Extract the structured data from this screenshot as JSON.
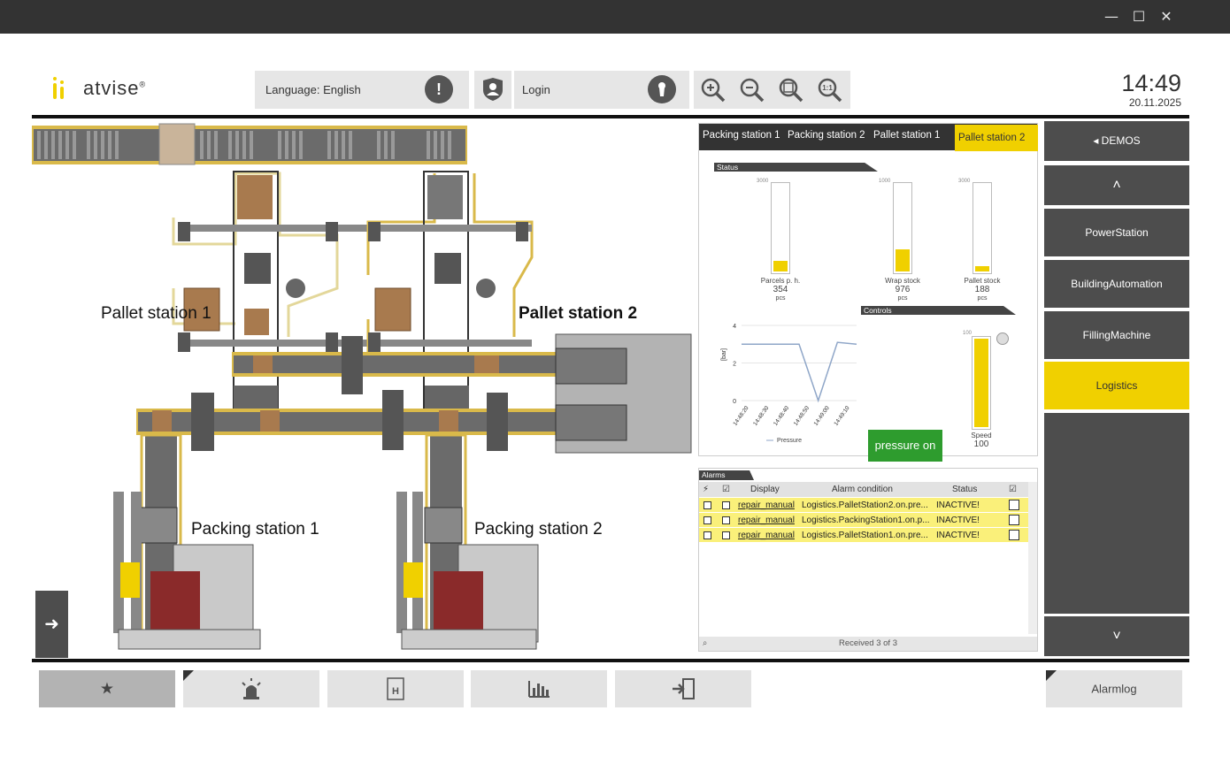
{
  "window": {
    "minimize_glyph": "—",
    "maximize_glyph": "☐",
    "close_glyph": "✕"
  },
  "header": {
    "logo_text": "atvise",
    "logo_reg": "®",
    "language_label": "Language: English",
    "login_label": "Login",
    "clock_time": "14:49",
    "clock_date": "20.11.2025",
    "zoom_in_label": "+",
    "zoom_out_label": "−",
    "zoom_fit_label": "□",
    "zoom_1to1_label": "1:1"
  },
  "process": {
    "labels": {
      "pallet1": "Pallet station 1",
      "pallet2": "Pallet station 2",
      "packing1": "Packing station 1",
      "packing2": "Packing station 2"
    },
    "exit_glyph": "➜"
  },
  "panel": {
    "tabs": [
      "Packing station 1",
      "Packing station 2",
      "Pallet station 1",
      "Pallet station 2"
    ],
    "active_tab": 3,
    "status_header": "Status",
    "controls_header": "Controls",
    "tanks": [
      {
        "top": "3000",
        "label": "Parcels p. h.",
        "value": "354",
        "unit": "pcs",
        "fill": 0.118
      },
      {
        "top": "1000",
        "label": "Wrap stock",
        "value": "976",
        "unit": "pcs",
        "fill": 0.25
      },
      {
        "top": "3000",
        "label": "Pallet stock",
        "value": "188",
        "unit": "pcs",
        "fill": 0.063
      }
    ],
    "speed": {
      "top": "100",
      "label": "Speed",
      "value": "100",
      "fill": 1.0
    },
    "pressure_button": "pressure on",
    "chart_legend": "Pressure"
  },
  "chart_data": {
    "type": "line",
    "x": [
      "14:48:20",
      "14:48:30",
      "14:48:40",
      "14:48:50",
      "14:49:00",
      "14:49:10"
    ],
    "ylabel": "[bar]",
    "yticks": [
      "0",
      "2",
      "4"
    ],
    "ylim": [
      0,
      4
    ],
    "series": [
      {
        "name": "Pressure",
        "values": [
          3.0,
          3.0,
          3.0,
          3.0,
          0.0,
          3.1,
          3.0
        ]
      }
    ]
  },
  "alarms": {
    "title": "Alarms",
    "columns": [
      "Display",
      "Alarm condition",
      "Status"
    ],
    "rows": [
      {
        "display": "repair_manual",
        "condition": "Logistics.PalletStation2.on.pre...",
        "status": "INACTIVE!"
      },
      {
        "display": "repair_manual",
        "condition": "Logistics.PackingStation1.on.p...",
        "status": "INACTIVE!"
      },
      {
        "display": "repair_manual",
        "condition": "Logistics.PalletStation1.on.pre...",
        "status": "INACTIVE!"
      }
    ],
    "footer": "Received 3 of 3"
  },
  "nav": {
    "demos": "◂ DEMOS",
    "up": "˄",
    "items": [
      "PowerStation",
      "BuildingAutomation",
      "FillingMachine",
      "Logistics"
    ],
    "active": "Logistics",
    "down": "˅"
  },
  "bottom": {
    "favorites_icon": "★",
    "alarm_icon": "🚨",
    "history_icon": "H",
    "trend_icon": "▥",
    "logout_icon": "⇥",
    "alarmlog_label": "Alarmlog"
  },
  "colors": {
    "accent": "#f0d000",
    "dark": "#4d4d4d",
    "titlebar": "#333333",
    "alarm_row": "#faf07a",
    "green": "#2e9c2e"
  }
}
